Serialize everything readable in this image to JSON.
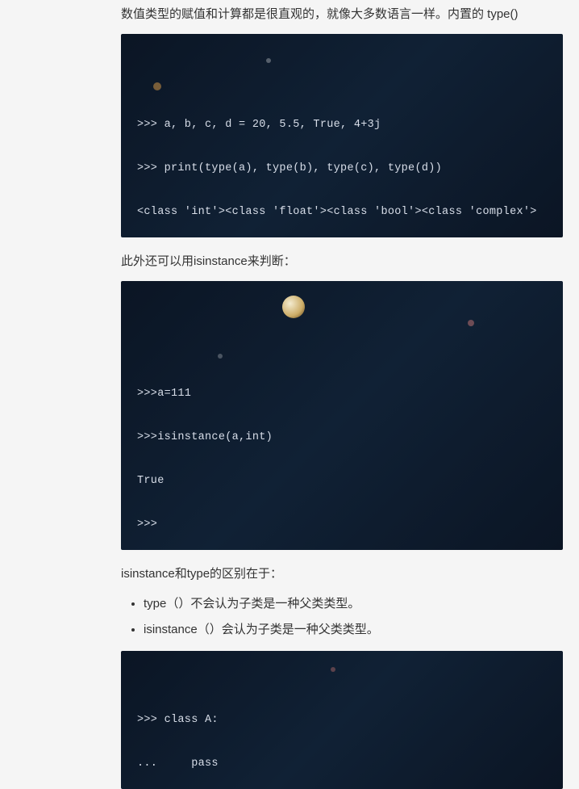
{
  "intro": "数值类型的赋值和计算都是很直观的，就像大多数语言一样。内置的 type()",
  "code1_l1": ">>> a, b, c, d = 20, 5.5, True, 4+3j",
  "code1_l2": ">>> print(type(a), type(b), type(c), type(d))",
  "code1_l3": "<class 'int'><class 'float'><class 'bool'><class 'complex'>",
  "p2": "此外还可以用isinstance来判断：",
  "code2_l1": ">>>a=111",
  "code2_l2": ">>>isinstance(a,int)",
  "code2_l3": "True",
  "code2_l4": ">>>",
  "p3": "isinstance和type的区别在于：",
  "bullet1": "type（）不会认为子类是一种父类类型。",
  "bullet2": "isinstance（）会认为子类是一种父类类型。",
  "code3_l1": ">>> class A:",
  "code3_l2": "...     pass"
}
